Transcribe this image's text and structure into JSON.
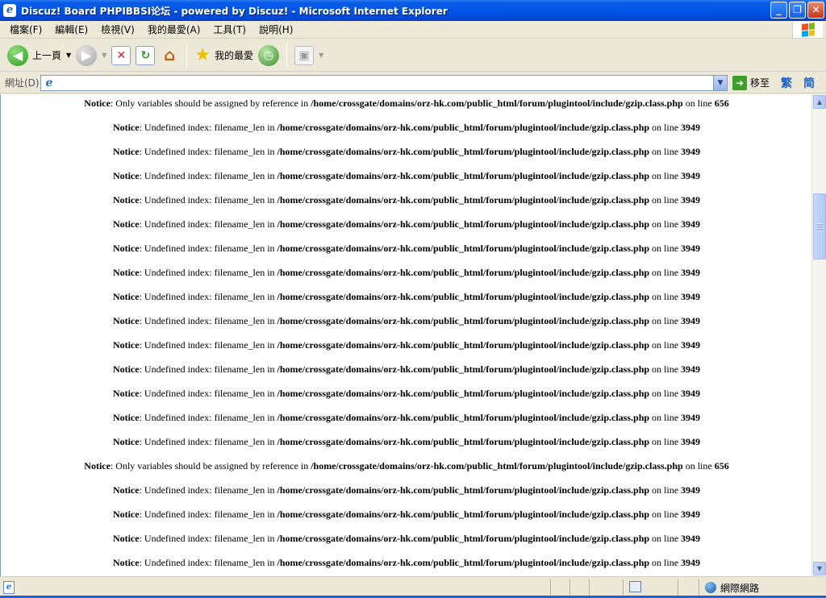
{
  "window": {
    "title": "Discuz! Board PHPIBBSI论坛 - powered by Discuz! - Microsoft Internet Explorer",
    "app_icon_glyph": "e",
    "controls": {
      "minimize": "_",
      "maximize": "❐",
      "close": "✕"
    }
  },
  "menu": {
    "items": [
      "檔案(F)",
      "編輯(E)",
      "檢視(V)",
      "我的最愛(A)",
      "工具(T)",
      "說明(H)"
    ]
  },
  "toolbar": {
    "back_label": "上一頁",
    "favorites_label": "我的最愛",
    "icons": [
      "back-icon",
      "forward-icon",
      "stop-icon",
      "refresh-icon",
      "home-icon",
      "favorites-star-icon",
      "history-icon",
      "media-icon"
    ]
  },
  "address": {
    "label": "網址(D)",
    "value": "",
    "go_label": "移至",
    "lang_traditional": "繁",
    "lang_simplified": "简"
  },
  "content": {
    "notices": [
      {
        "prefix": "Notice",
        "msg": ": Only variables should be assigned by reference in ",
        "path": "/home/crossgate/domains/orz-hk.com/public_html/forum/plugintool/include/gzip.class.php",
        "online": " on line ",
        "line": "656"
      },
      {
        "prefix": "Notice",
        "msg": ": Undefined index: filename_len in ",
        "path": "/home/crossgate/domains/orz-hk.com/public_html/forum/plugintool/include/gzip.class.php",
        "online": " on line ",
        "line": "3949"
      },
      {
        "prefix": "Notice",
        "msg": ": Undefined index: filename_len in ",
        "path": "/home/crossgate/domains/orz-hk.com/public_html/forum/plugintool/include/gzip.class.php",
        "online": " on line ",
        "line": "3949"
      },
      {
        "prefix": "Notice",
        "msg": ": Undefined index: filename_len in ",
        "path": "/home/crossgate/domains/orz-hk.com/public_html/forum/plugintool/include/gzip.class.php",
        "online": " on line ",
        "line": "3949"
      },
      {
        "prefix": "Notice",
        "msg": ": Undefined index: filename_len in ",
        "path": "/home/crossgate/domains/orz-hk.com/public_html/forum/plugintool/include/gzip.class.php",
        "online": " on line ",
        "line": "3949"
      },
      {
        "prefix": "Notice",
        "msg": ": Undefined index: filename_len in ",
        "path": "/home/crossgate/domains/orz-hk.com/public_html/forum/plugintool/include/gzip.class.php",
        "online": " on line ",
        "line": "3949"
      },
      {
        "prefix": "Notice",
        "msg": ": Undefined index: filename_len in ",
        "path": "/home/crossgate/domains/orz-hk.com/public_html/forum/plugintool/include/gzip.class.php",
        "online": " on line ",
        "line": "3949"
      },
      {
        "prefix": "Notice",
        "msg": ": Undefined index: filename_len in ",
        "path": "/home/crossgate/domains/orz-hk.com/public_html/forum/plugintool/include/gzip.class.php",
        "online": " on line ",
        "line": "3949"
      },
      {
        "prefix": "Notice",
        "msg": ": Undefined index: filename_len in ",
        "path": "/home/crossgate/domains/orz-hk.com/public_html/forum/plugintool/include/gzip.class.php",
        "online": " on line ",
        "line": "3949"
      },
      {
        "prefix": "Notice",
        "msg": ": Undefined index: filename_len in ",
        "path": "/home/crossgate/domains/orz-hk.com/public_html/forum/plugintool/include/gzip.class.php",
        "online": " on line ",
        "line": "3949"
      },
      {
        "prefix": "Notice",
        "msg": ": Undefined index: filename_len in ",
        "path": "/home/crossgate/domains/orz-hk.com/public_html/forum/plugintool/include/gzip.class.php",
        "online": " on line ",
        "line": "3949"
      },
      {
        "prefix": "Notice",
        "msg": ": Undefined index: filename_len in ",
        "path": "/home/crossgate/domains/orz-hk.com/public_html/forum/plugintool/include/gzip.class.php",
        "online": " on line ",
        "line": "3949"
      },
      {
        "prefix": "Notice",
        "msg": ": Undefined index: filename_len in ",
        "path": "/home/crossgate/domains/orz-hk.com/public_html/forum/plugintool/include/gzip.class.php",
        "online": " on line ",
        "line": "3949"
      },
      {
        "prefix": "Notice",
        "msg": ": Undefined index: filename_len in ",
        "path": "/home/crossgate/domains/orz-hk.com/public_html/forum/plugintool/include/gzip.class.php",
        "online": " on line ",
        "line": "3949"
      },
      {
        "prefix": "Notice",
        "msg": ": Undefined index: filename_len in ",
        "path": "/home/crossgate/domains/orz-hk.com/public_html/forum/plugintool/include/gzip.class.php",
        "online": " on line ",
        "line": "3949"
      },
      {
        "prefix": "Notice",
        "msg": ": Only variables should be assigned by reference in ",
        "path": "/home/crossgate/domains/orz-hk.com/public_html/forum/plugintool/include/gzip.class.php",
        "online": " on line ",
        "line": "656"
      },
      {
        "prefix": "Notice",
        "msg": ": Undefined index: filename_len in ",
        "path": "/home/crossgate/domains/orz-hk.com/public_html/forum/plugintool/include/gzip.class.php",
        "online": " on line ",
        "line": "3949"
      },
      {
        "prefix": "Notice",
        "msg": ": Undefined index: filename_len in ",
        "path": "/home/crossgate/domains/orz-hk.com/public_html/forum/plugintool/include/gzip.class.php",
        "online": " on line ",
        "line": "3949"
      },
      {
        "prefix": "Notice",
        "msg": ": Undefined index: filename_len in ",
        "path": "/home/crossgate/domains/orz-hk.com/public_html/forum/plugintool/include/gzip.class.php",
        "online": " on line ",
        "line": "3949"
      },
      {
        "prefix": "Notice",
        "msg": ": Undefined index: filename_len in ",
        "path": "/home/crossgate/domains/orz-hk.com/public_html/forum/plugintool/include/gzip.class.php",
        "online": " on line ",
        "line": "3949"
      }
    ]
  },
  "statusbar": {
    "text": "",
    "zone_label": "網際網路"
  },
  "colors": {
    "titlebar": "#0055e5",
    "chrome": "#ece9d8",
    "content_bg": "#ffffff"
  }
}
